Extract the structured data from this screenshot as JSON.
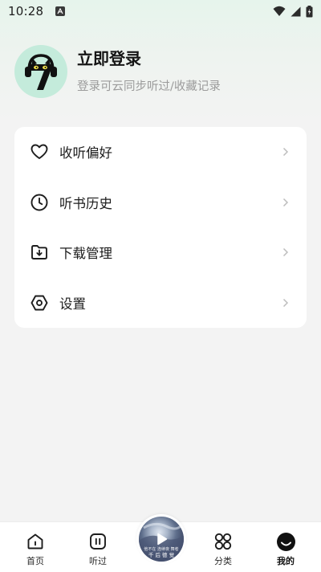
{
  "status_bar": {
    "time": "10:28"
  },
  "profile": {
    "title": "立即登录",
    "subtitle": "登录可云同步听过/收藏记录",
    "avatar_icon": "cat-with-headphones-icon",
    "avatar_bg": "#c4ebdb"
  },
  "menu": {
    "items": [
      {
        "label": "收听偏好",
        "icon": "heart-icon"
      },
      {
        "label": "听书历史",
        "icon": "clock-icon"
      },
      {
        "label": "下载管理",
        "icon": "download-folder-icon"
      },
      {
        "label": "设置",
        "icon": "settings-icon"
      }
    ]
  },
  "bottom_nav": {
    "items": [
      {
        "label": "首页",
        "icon": "home-icon"
      },
      {
        "label": "听过",
        "icon": "listened-icon"
      },
      {
        "label": "分类",
        "icon": "category-icon"
      },
      {
        "label": "我的",
        "icon": "profile-icon",
        "active": true
      }
    ],
    "player": {
      "cover_line1": "他不在 连续夜 舞者",
      "cover_line2": "千 后 德 觉"
    }
  }
}
